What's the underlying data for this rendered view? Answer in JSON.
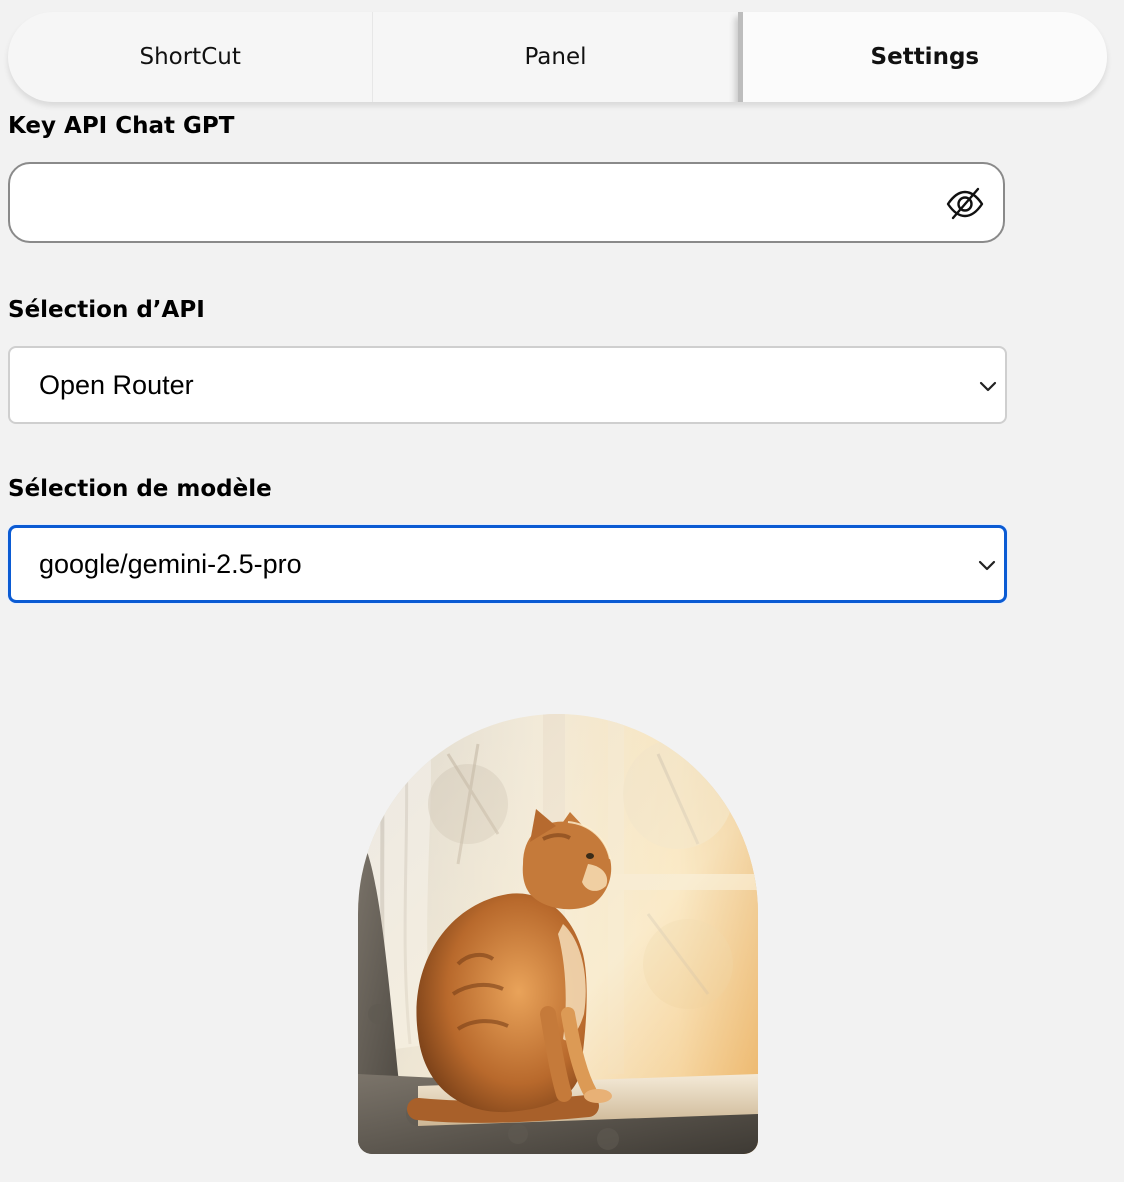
{
  "tabs": [
    {
      "label": "ShortCut",
      "active": false
    },
    {
      "label": "Panel",
      "active": false
    },
    {
      "label": "Settings",
      "active": true
    }
  ],
  "api_key": {
    "label": "Key API Chat GPT",
    "value": "",
    "visibility_icon": "eye-slash-icon"
  },
  "api_selection": {
    "label": "Sélection d’API",
    "value": "Open Router"
  },
  "model_selection": {
    "label": "Sélection de modèle",
    "value": "google/gemini-2.5-pro"
  },
  "illustration": {
    "subject": "cat-by-window-image"
  },
  "colors": {
    "background": "#f2f2f2",
    "focus_border": "#0b5bd3",
    "input_border": "#8a8a8a"
  }
}
